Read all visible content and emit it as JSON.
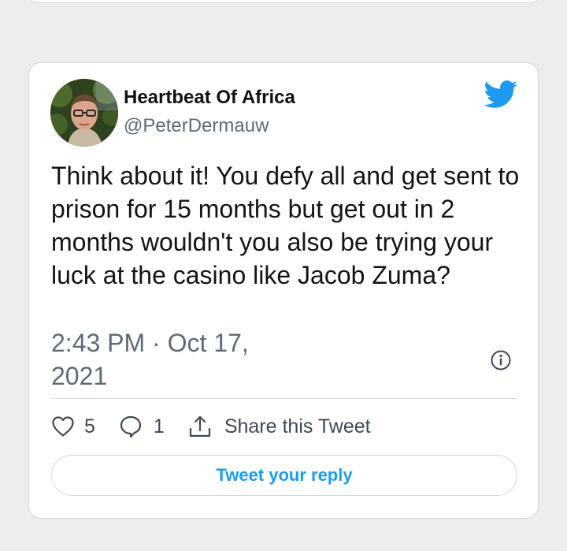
{
  "author": {
    "display_name": "Heartbeat Of Africa",
    "handle": "@PeterDermauw"
  },
  "tweet": {
    "text": "Think about it! You defy all and get sent to prison for 15 months but get out in 2 months wouldn't you also be trying your luck at the casino like Jacob Zuma?",
    "timestamp": "2:43 PM · Oct 17, 2021"
  },
  "actions": {
    "like_count": "5",
    "reply_count": "1",
    "share_label": "Share this Tweet"
  },
  "reply_button": {
    "label": "Tweet your reply"
  },
  "icons": {
    "brand": "twitter-bird-icon",
    "info": "info-icon",
    "like": "heart-icon",
    "reply": "speech-bubble-icon",
    "share": "share-icon"
  },
  "colors": {
    "brand_blue": "#1d9bf0",
    "secondary_text": "#5c6b77",
    "background": "#ededed"
  }
}
